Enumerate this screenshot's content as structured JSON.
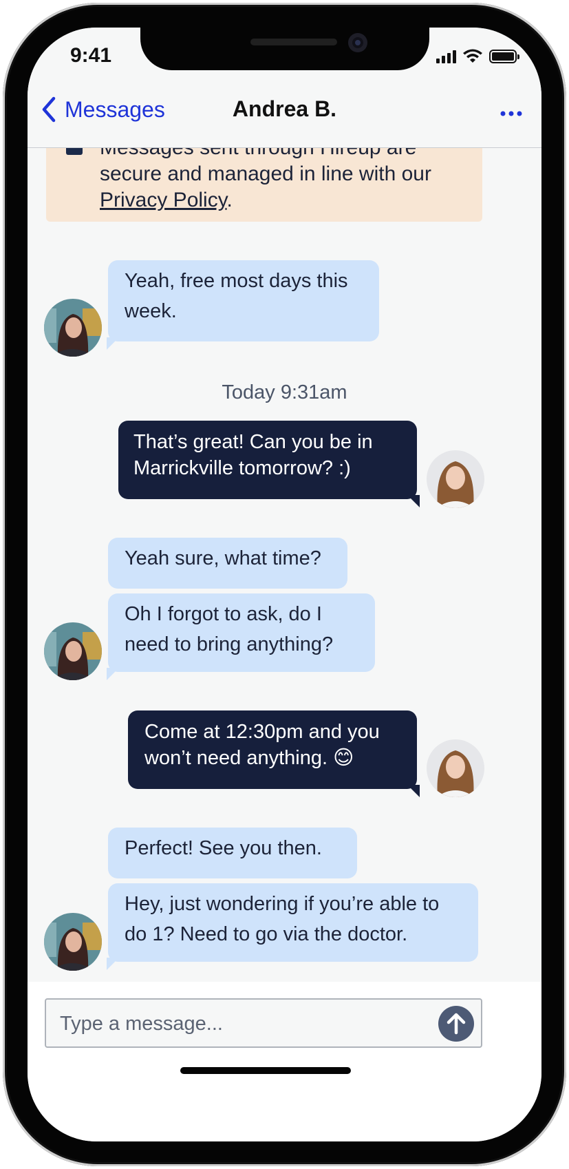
{
  "status_bar": {
    "time": "9:41"
  },
  "header": {
    "back_label": "Messages",
    "title": "Andrea B.",
    "more_label": "•••"
  },
  "notice": {
    "text_before": "Messages sent through Hireup are secure and managed in line with our ",
    "link_label": "Privacy Policy",
    "text_after": "."
  },
  "messages": [
    {
      "id": "m1",
      "direction": "incoming",
      "text": "Yeah, free most days this week."
    },
    {
      "id": "m2",
      "direction": "outgoing",
      "text": "That’s great! Can you be in Marrickville tomorrow? :)"
    },
    {
      "id": "m3",
      "direction": "incoming",
      "text": "Yeah sure, what time?"
    },
    {
      "id": "m4",
      "direction": "incoming",
      "text": "Oh I forgot to ask, do I need to bring anything?"
    },
    {
      "id": "m5",
      "direction": "outgoing",
      "text": "Come at 12:30pm and you won’t need anything. 😊"
    },
    {
      "id": "m6",
      "direction": "incoming",
      "text": "Perfect! See you then."
    },
    {
      "id": "m7",
      "direction": "incoming",
      "text": "Hey, just wondering if you’re able to do 1? Need to go via the doctor."
    }
  ],
  "timestamp": "Today 9:31am",
  "composer": {
    "placeholder": "Type a message..."
  },
  "icons": {
    "back": "chevron-left-icon",
    "more": "more-horizontal-icon",
    "info": "info-icon",
    "send": "arrow-up-icon"
  },
  "colors": {
    "accent": "#1f34d8",
    "incoming_bubble": "#cfe3fb",
    "outgoing_bubble": "#161f3c",
    "notice_bg": "#f8e6d4",
    "send_button": "#4d5a75"
  }
}
